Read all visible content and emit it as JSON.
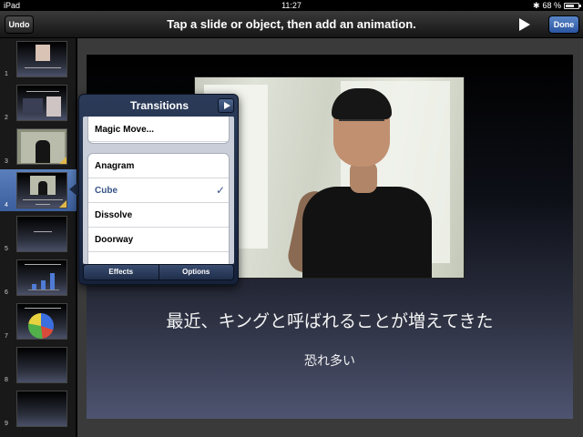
{
  "status_bar": {
    "carrier": "iPad",
    "time": "11:27",
    "battery": "68 %",
    "battery_fraction": 0.68
  },
  "toolbar": {
    "undo_label": "Undo",
    "title": "Tap a slide or object, then add an animation.",
    "done_label": "Done"
  },
  "navigator": {
    "slides": [
      {
        "number": "1",
        "selected": false
      },
      {
        "number": "2",
        "selected": false
      },
      {
        "number": "3",
        "selected": false
      },
      {
        "number": "4",
        "selected": true
      },
      {
        "number": "5",
        "selected": false
      },
      {
        "number": "6",
        "selected": false
      },
      {
        "number": "7",
        "selected": false
      },
      {
        "number": "8",
        "selected": false
      },
      {
        "number": "9",
        "selected": false
      }
    ]
  },
  "slide": {
    "title": "最近、キングと呼ばれることが増えてきた",
    "subtitle": "恐れ多い"
  },
  "popover": {
    "title": "Transitions",
    "magic_move": "Magic Move...",
    "items": [
      {
        "label": "Anagram",
        "checked": false
      },
      {
        "label": "Cube",
        "checked": true
      },
      {
        "label": "Dissolve",
        "checked": false
      },
      {
        "label": "Doorway",
        "checked": false
      }
    ],
    "check_mark": "✓",
    "tab_effects": "Effects",
    "tab_options": "Options"
  },
  "colors": {
    "accent": "#385487",
    "done_button": "#3a66b0",
    "selection": "#4a6fae"
  }
}
